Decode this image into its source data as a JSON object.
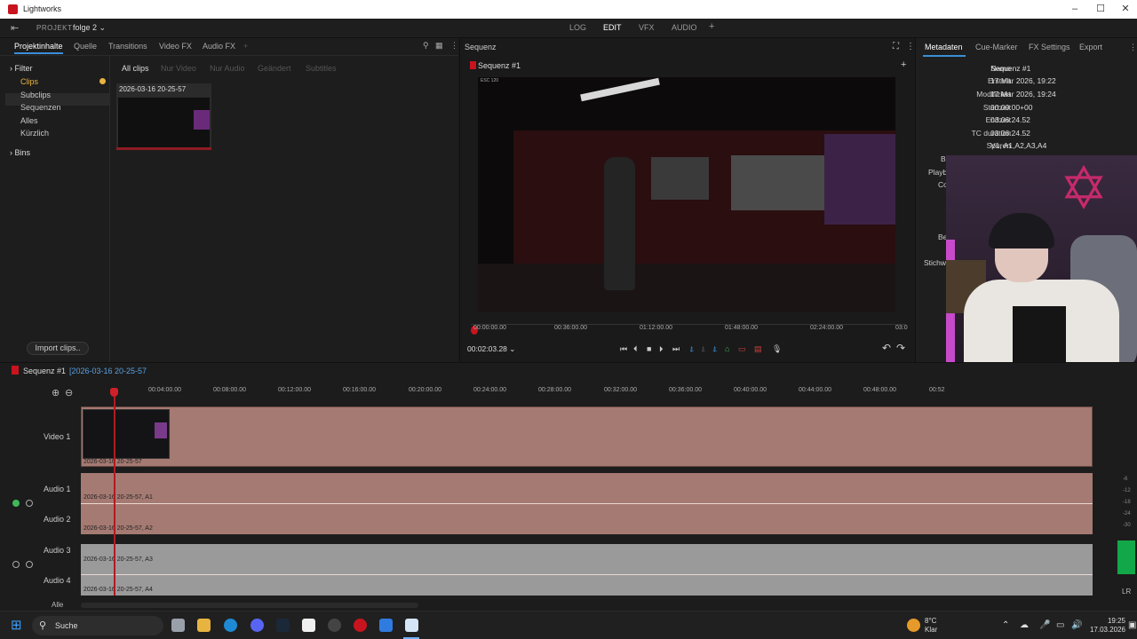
{
  "window": {
    "title": "Lightworks",
    "controls": [
      "–",
      "☐",
      "✕"
    ]
  },
  "menubar": {
    "project_label": "PROJEKT",
    "project_name": "folge 2 ⌄",
    "tabs": [
      "LOG",
      "EDIT",
      "VFX",
      "AUDIO",
      "+"
    ],
    "active_tab": "EDIT"
  },
  "left_panel": {
    "tabs": [
      "Projektinhalte",
      "Quelle",
      "Transitions",
      "Video FX",
      "Audio FX",
      "+"
    ],
    "sidebar": {
      "filter": "Filter",
      "items": [
        "Clips",
        "Subclips",
        "Sequenzen",
        "Alles",
        "Kürzlich"
      ],
      "bins": "Bins"
    },
    "filters": [
      "All clips",
      "Nur Video",
      "Nur Audio",
      "Geändert",
      "Subtitles"
    ],
    "clip_name": "2026-03-16 20-25-57",
    "import_button": "Import clips.."
  },
  "viewer": {
    "header": "Sequenz",
    "sequence_title": "Sequenz #1",
    "video_overlay": "ESC  120",
    "ruler_ticks": [
      "00:00:00.00",
      "00:36:00.00",
      "01:12:00.00",
      "01:48:00.00",
      "02:24:00.00",
      "03:0"
    ],
    "timecode": "00:02:03.28 ⌄"
  },
  "meta_panel": {
    "tabs": [
      "Metadaten",
      "Cue-Marker",
      "FX Settings",
      "Export"
    ],
    "rows": [
      {
        "k": "Name",
        "v": "Sequenz #1"
      },
      {
        "k": "Erstellt",
        "v": "17 Mar 2026, 19:22"
      },
      {
        "k": "Modifiziert",
        "v": "17 Mar 2026, 19:24"
      },
      {
        "k": "Startzeit",
        "v": "00:00:00+00"
      },
      {
        "k": "Endzeit",
        "v": "03:06:24.52"
      },
      {
        "k": "TC duration",
        "v": "03:06:24.52"
      },
      {
        "k": "Spuren",
        "v": "V1, A1,A2,A3,A4"
      }
    ],
    "partial_labels": [
      "Bi",
      "Playb",
      "Co",
      "Be",
      "Stichw"
    ]
  },
  "timeline": {
    "sequence": "Sequenz #1",
    "clip": "[2026-03-16 20-25-57",
    "ticks": [
      "00:04:00.00",
      "00:08:00.00",
      "00:12:00.00",
      "00:16:00.00",
      "00:20:00.00",
      "00:24:00.00",
      "00:28:00.00",
      "00:32:00.00",
      "00:36:00.00",
      "00:40:00.00",
      "00:44:00.00",
      "00:48:00.00",
      "00:52"
    ],
    "tracks": [
      "Video 1",
      "Audio 1",
      "Audio 2",
      "Audio 3",
      "Audio 4"
    ],
    "clip_labels": {
      "v1": "2026-03-16 20-25-57",
      "a1": "2026-03-16 20-25-57, A1",
      "a2": "2026-03-16 20-25-57, A2",
      "a3": "2026-03-16 20-25-57, A3",
      "a4": "2026-03-16 20-25-57, A4"
    },
    "alle": "Alle",
    "meter_labels": [
      "-6",
      "-12",
      "-18",
      "-24",
      "-30"
    ],
    "lr": "LR"
  },
  "taskbar": {
    "search": "Suche",
    "temp": "8°C",
    "weather": "Klar",
    "time": "19:25",
    "date": "17.03.2026"
  },
  "colors": {
    "accent": "#c8141e",
    "link": "#5aa0e0",
    "track_video": "#a57a72",
    "track_audio_muted": "#9a9a9a"
  }
}
